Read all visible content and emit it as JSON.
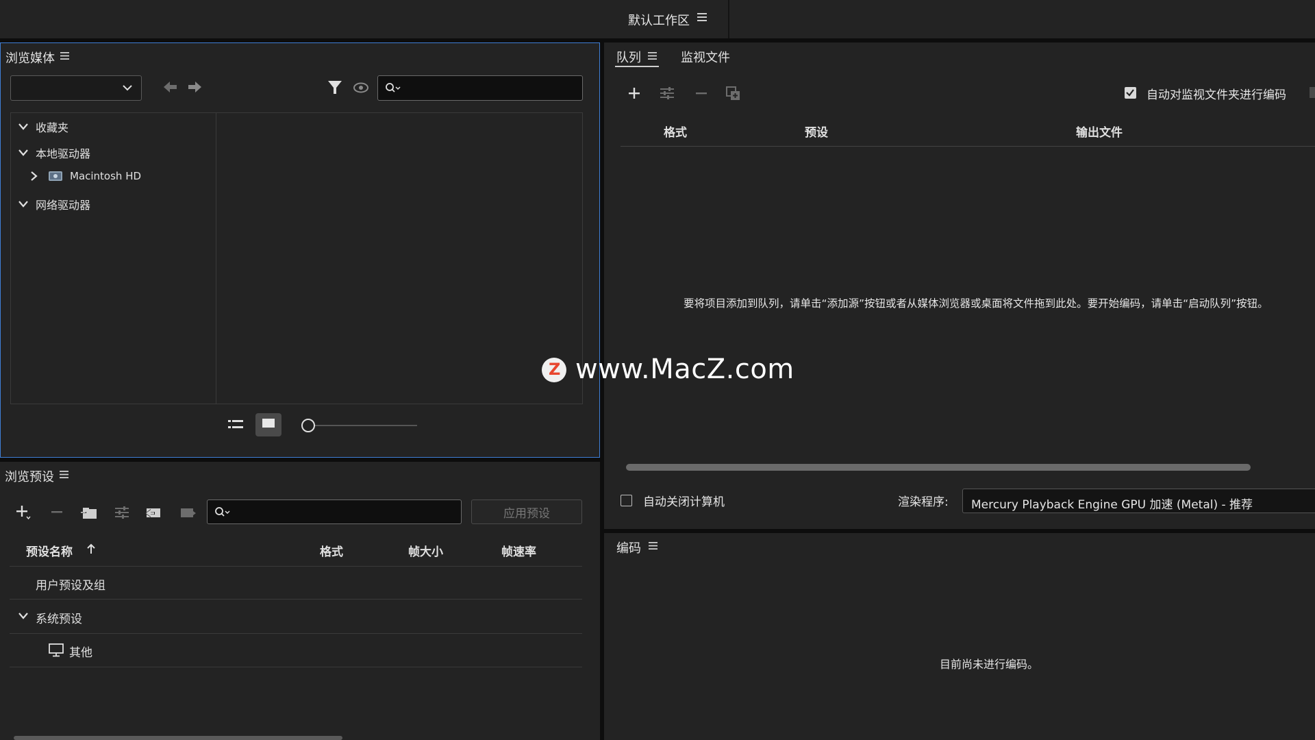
{
  "workspace": {
    "title": "默认工作区"
  },
  "media_browser": {
    "title": "浏览媒体",
    "dropdown_value": "",
    "search_placeholder": "",
    "tree": [
      {
        "label": "收藏夹",
        "expanded": true
      },
      {
        "label": "本地驱动器",
        "expanded": true
      },
      {
        "label": "Macintosh HD",
        "expanded": false
      },
      {
        "label": "网络驱动器",
        "expanded": true
      }
    ]
  },
  "presets": {
    "title": "浏览预设",
    "search_placeholder": "",
    "apply_label": "应用预设",
    "columns": {
      "name": "预设名称",
      "format": "格式",
      "frame_size": "帧大小",
      "frame_rate": "帧速率"
    },
    "rows": [
      {
        "label": "用户预设及组"
      },
      {
        "label": "系统预设"
      },
      {
        "label": "其他"
      }
    ]
  },
  "queue": {
    "tabs": [
      {
        "label": "队列"
      },
      {
        "label": "监视文件"
      }
    ],
    "auto_encode_label": "自动对监视文件夹进行编码",
    "auto_encode_checked": true,
    "columns": {
      "format": "格式",
      "preset": "预设",
      "output": "输出文件"
    },
    "hint": "要将项目添加到队列，请单击“添加源”按钮或者从媒体浏览器或桌面将文件拖到此处。要开始编码，请单击“启动队列”按钮。",
    "auto_shutdown_label": "自动关闭计算机",
    "auto_shutdown_checked": false,
    "renderer_label": "渲染程序:",
    "renderer_value": "Mercury Playback Engine GPU 加速 (Metal) - 推荐"
  },
  "encoding": {
    "title": "编码",
    "status": "目前尚未进行编码。"
  },
  "watermark": {
    "text": "www.MacZ.com",
    "logo_letter": "Z"
  },
  "colors": {
    "panel_bg": "#232323",
    "focus_border": "#3f7fd6",
    "divider": "#0d0d0d"
  }
}
